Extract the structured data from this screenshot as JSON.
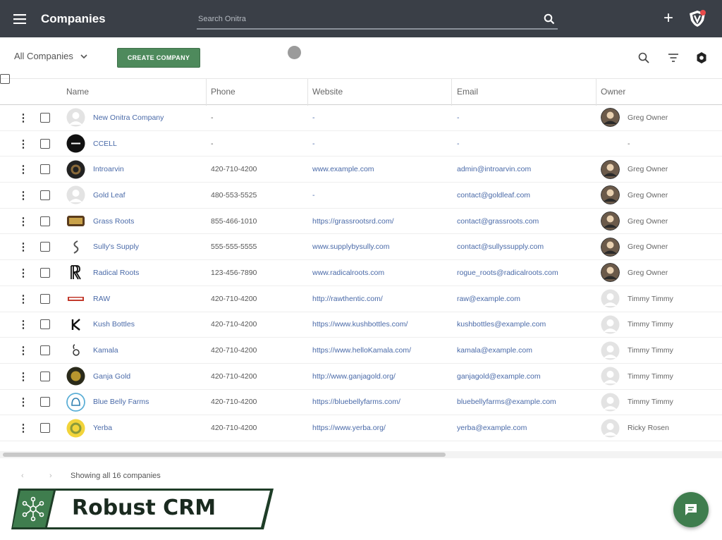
{
  "app": {
    "title": "Companies"
  },
  "search": {
    "placeholder": "Search Onitra"
  },
  "toolbar": {
    "view_label": "All Companies",
    "create_label": "CREATE COMPANY"
  },
  "columns": [
    "Name",
    "Phone",
    "Website",
    "Email",
    "Owner"
  ],
  "rows": [
    {
      "name": "New Onitra Company",
      "phone": "-",
      "website": "-",
      "email": "-",
      "owner": "Greg Owner",
      "logo": "person-placeholder",
      "owner_avatar": "photo"
    },
    {
      "name": "CCELL",
      "phone": "-",
      "website": "-",
      "email": "-",
      "owner": "-",
      "logo": "dark-circle",
      "owner_avatar": "none"
    },
    {
      "name": "Introarvin",
      "phone": "420-710-4200",
      "website": "www.example.com",
      "email": "admin@introarvin.com",
      "owner": "Greg Owner",
      "logo": "dark-badge",
      "owner_avatar": "photo"
    },
    {
      "name": "Gold Leaf",
      "phone": "480-553-5525",
      "website": "-",
      "email": "contact@goldleaf.com",
      "owner": "Greg Owner",
      "logo": "person-placeholder",
      "owner_avatar": "photo"
    },
    {
      "name": "Grass Roots",
      "phone": "855-466-1010",
      "website": "https://grassrootsrd.com/",
      "email": "contact@grassroots.com",
      "owner": "Greg Owner",
      "logo": "brown-badge",
      "owner_avatar": "photo"
    },
    {
      "name": "Sully's Supply",
      "phone": "555-555-5555",
      "website": "www.supplybysully.com",
      "email": "contact@sullyssupply.com",
      "owner": "Greg Owner",
      "logo": "swirl",
      "owner_avatar": "photo"
    },
    {
      "name": "Radical Roots",
      "phone": "123-456-7890",
      "website": "www.radicalroots.com",
      "email": "rogue_roots@radicalroots.com",
      "owner": "Greg Owner",
      "logo": "rr-monogram",
      "owner_avatar": "photo"
    },
    {
      "name": "RAW",
      "phone": "420-710-4200",
      "website": "http://rawthentic.com/",
      "email": "raw@example.com",
      "owner": "Timmy Timmy",
      "logo": "red-wordmark",
      "owner_avatar": "placeholder"
    },
    {
      "name": "Kush Bottles",
      "phone": "420-710-4200",
      "website": "https://www.kushbottles.com/",
      "email": "kushbottles@example.com",
      "owner": "Timmy Timmy",
      "logo": "k-mark",
      "owner_avatar": "placeholder"
    },
    {
      "name": "Kamala",
      "phone": "420-710-4200",
      "website": "https://www.helloKamala.com/",
      "email": "kamala@example.com",
      "owner": "Timmy Timmy",
      "logo": "leaf-mark",
      "owner_avatar": "placeholder"
    },
    {
      "name": "Ganja Gold",
      "phone": "420-710-4200",
      "website": "http://www.ganjagold.org/",
      "email": "ganjagold@example.com",
      "owner": "Timmy Timmy",
      "logo": "gold-circle",
      "owner_avatar": "placeholder"
    },
    {
      "name": "Blue Belly Farms",
      "phone": "420-710-4200",
      "website": "https://bluebellyfarms.com/",
      "email": "bluebellyfarms@example.com",
      "owner": "Timmy Timmy",
      "logo": "blue-bell",
      "owner_avatar": "placeholder"
    },
    {
      "name": "Yerba",
      "phone": "420-710-4200",
      "website": "https://www.yerba.org/",
      "email": "yerba@example.com",
      "owner": "Ricky Rosen",
      "logo": "yellow-circle",
      "owner_avatar": "placeholder"
    }
  ],
  "footer": {
    "showing": "Showing all 16 companies"
  },
  "brand": {
    "name": "Robust CRM"
  },
  "colors": {
    "appbar": "#3a3f47",
    "primary_green": "#4e8a5c",
    "link_blue": "#4a6aa8",
    "badge_dark_green": "#2f5e3c"
  },
  "icons": [
    "menu-icon",
    "search-icon",
    "plus-icon",
    "shield-logo-icon",
    "chevron-down-icon",
    "filter-icon",
    "settings-icon",
    "kebab-icon",
    "chat-icon",
    "network-icon"
  ]
}
